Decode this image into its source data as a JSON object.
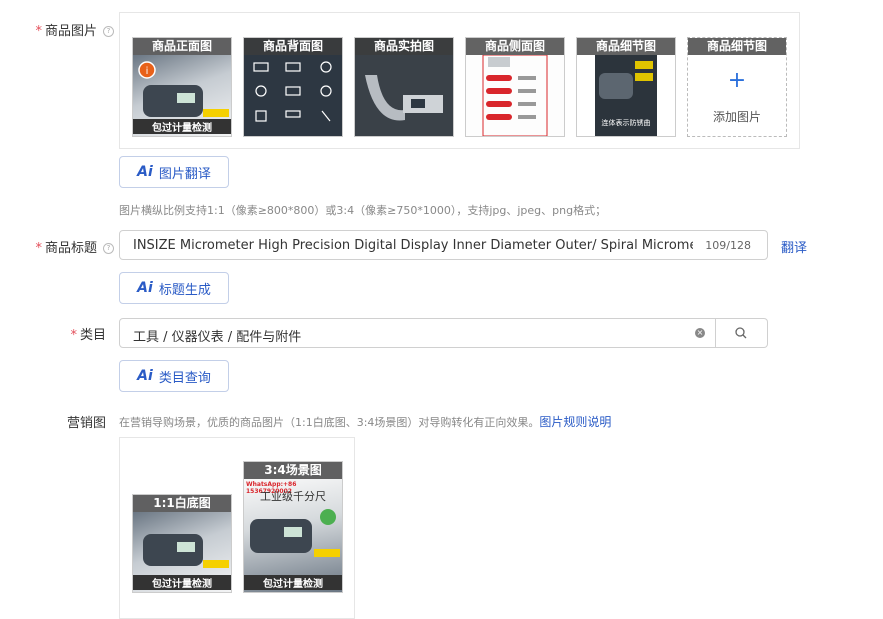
{
  "product_images": {
    "label": "商品图片",
    "help_icon": "question-icon",
    "thumbnails": [
      {
        "caption": "商品正面图",
        "overlay_text": "包过计量检测"
      },
      {
        "caption": "商品背面图",
        "overlay_text": ""
      },
      {
        "caption": "商品实拍图",
        "overlay_text": ""
      },
      {
        "caption": "商品侧面图",
        "overlay_text": ""
      },
      {
        "caption": "商品细节图",
        "overlay_text": "连体表示防锈曲"
      },
      {
        "caption": "商品细节图",
        "add_label": "添加图片"
      }
    ],
    "translate_button": "图片翻译",
    "hint": "图片横纵比例支持1:1（像素≥800*800）或3:4（像素≥750*1000），支持jpg、jpeg、png格式；"
  },
  "product_title": {
    "label": "商品标题",
    "value": "INSIZE Micrometer High Precision Digital Display Inner Diameter Outer/ Spiral Micrometer Thickness Gauge",
    "count": "109/128",
    "translate_link": "翻译",
    "generate_button": "标题生成"
  },
  "category": {
    "label": "类目",
    "value": "工具 / 仪器仪表 / 配件与附件",
    "query_button": "类目查询"
  },
  "marketing": {
    "label": "营销图",
    "description": "在营销导购场景，优质的商品图片（1:1白底图、3:4场景图）对导购转化有正向效果。",
    "rules_link": "图片规则说明",
    "images": [
      {
        "caption": "1:1白底图",
        "overlay_text": "包过计量检测"
      },
      {
        "caption": "3:4场景图",
        "overlay_text": "包过计量检测",
        "top_text": "WhatsApp:+86 15367920002",
        "banner": "工业级千分尺"
      }
    ]
  },
  "colors": {
    "accent": "#2a5bc6",
    "required": "#e34d59"
  }
}
